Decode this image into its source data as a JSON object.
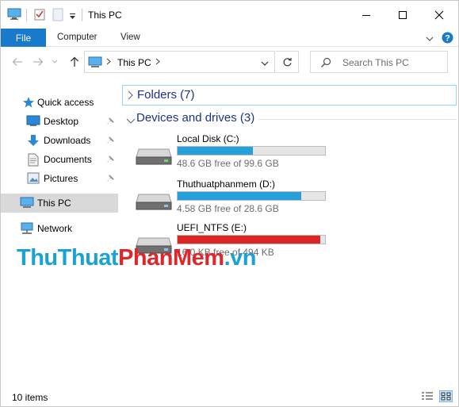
{
  "window": {
    "title": "This PC",
    "controls": [
      "minimize",
      "maximize",
      "close"
    ]
  },
  "ribbon": {
    "tabs": [
      {
        "label": "File",
        "active": true
      },
      {
        "label": "Computer"
      },
      {
        "label": "View"
      }
    ]
  },
  "address": {
    "crumb": "This PC",
    "search_placeholder": "Search This PC"
  },
  "sidebar": {
    "items": [
      {
        "label": "Quick access",
        "icon": "star-icon"
      },
      {
        "label": "Desktop",
        "icon": "desktop-icon",
        "pinned": true
      },
      {
        "label": "Downloads",
        "icon": "download-arrow-icon",
        "pinned": true
      },
      {
        "label": "Documents",
        "icon": "document-icon",
        "pinned": true
      },
      {
        "label": "Pictures",
        "icon": "pictures-icon",
        "pinned": true
      },
      {
        "label": "This PC",
        "icon": "computer-icon",
        "selected": true
      },
      {
        "label": "Network",
        "icon": "network-icon"
      }
    ]
  },
  "content": {
    "folders_group": "Folders (7)",
    "devices_group": "Devices and drives (3)",
    "drives": [
      {
        "name": "Local Disk (C:)",
        "free_text": "48.6 GB free of 99.6 GB",
        "used_fraction": 0.51,
        "bar_color": "#26a0da"
      },
      {
        "name": "Thuthuatphanmem (D:)",
        "free_text": "4.58 GB free of 28.6 GB",
        "used_fraction": 0.84,
        "bar_color": "#26a0da"
      },
      {
        "name": "UEFI_NTFS (E:)",
        "free_text": "16.0 KB free of 494 KB",
        "used_fraction": 0.97,
        "bar_color": "#da2626"
      }
    ]
  },
  "watermark": {
    "part1": "ThuThuat",
    "part2": "PhanMem",
    "part3": ".vn",
    "color1": "#1aa1d6",
    "color2": "#e0262b"
  },
  "status": {
    "item_count": "10 items"
  },
  "colors": {
    "accent": "#1979ca",
    "selection": "#d9d9d9",
    "group_title": "#1e3287"
  }
}
